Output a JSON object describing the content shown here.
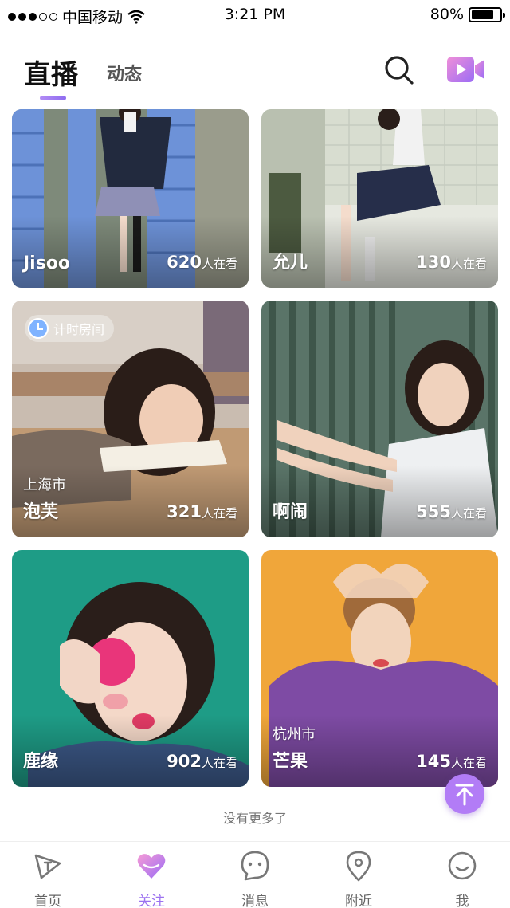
{
  "status_bar": {
    "carrier": "中国移动",
    "time": "3:21 PM",
    "battery": "80%",
    "battery_level": 0.8
  },
  "header": {
    "tabs": [
      {
        "label": "直播",
        "active": true
      },
      {
        "label": "动态",
        "active": false
      }
    ],
    "icons": [
      "search-icon",
      "video-camera-icon"
    ]
  },
  "cards": [
    {
      "name": "Jisoo",
      "viewers": "620",
      "viewer_unit": "人在看"
    },
    {
      "name": "允儿",
      "viewers": "130",
      "viewer_unit": "人在看"
    },
    {
      "badge": "计时房间",
      "city": "上海市",
      "name": "泡芙",
      "viewers": "321",
      "viewer_unit": "人在看"
    },
    {
      "name": "啊闹",
      "viewers": "555",
      "viewer_unit": "人在看"
    },
    {
      "name": "鹿缘",
      "viewers": "902",
      "viewer_unit": "人在看"
    },
    {
      "city": "杭州市",
      "name": "芒果",
      "viewers": "145",
      "viewer_unit": "人在看"
    }
  ],
  "end_text": "没有更多了",
  "bottom_nav": [
    {
      "label": "首页",
      "icon": "home-icon"
    },
    {
      "label": "关注",
      "icon": "heart-icon",
      "active": true
    },
    {
      "label": "消息",
      "icon": "message-icon"
    },
    {
      "label": "附近",
      "icon": "location-icon"
    },
    {
      "label": "我",
      "icon": "profile-icon"
    }
  ],
  "colors": {
    "accent": "#9c72f0",
    "scroll_top": "#b27cf6"
  }
}
